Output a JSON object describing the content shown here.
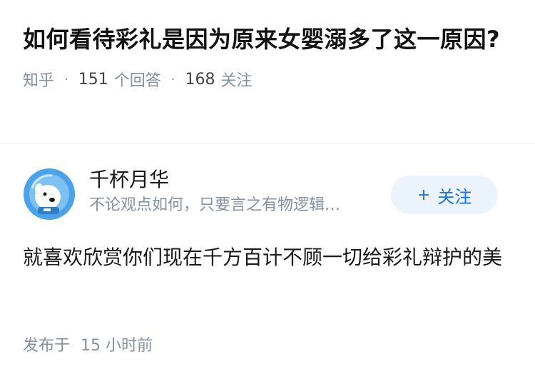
{
  "question": {
    "title": "如何看待彩礼是因为原来女婴溺多了这一原因?",
    "source": "知乎",
    "answer_count": "151",
    "answer_label": "个回答",
    "follower_count": "168",
    "follower_label": "关注"
  },
  "answer": {
    "author_name": "千杯月华",
    "author_bio": "不论观点如何，只要言之有物逻辑…",
    "follow_label": "关注",
    "content": "就喜欢欣赏你们现在千方百计不顾一切给彩礼辩护的美",
    "published_prefix": "发布于",
    "published_time": "15 小时前"
  },
  "icons": {
    "avatar": "dog-astronaut-avatar",
    "follow": "plus-icon"
  },
  "colors": {
    "accent": "#1772f6",
    "follow_bg": "#ebf3fc",
    "meta_gray": "#8590a6",
    "avatar_blue": "#4aa3e8"
  }
}
